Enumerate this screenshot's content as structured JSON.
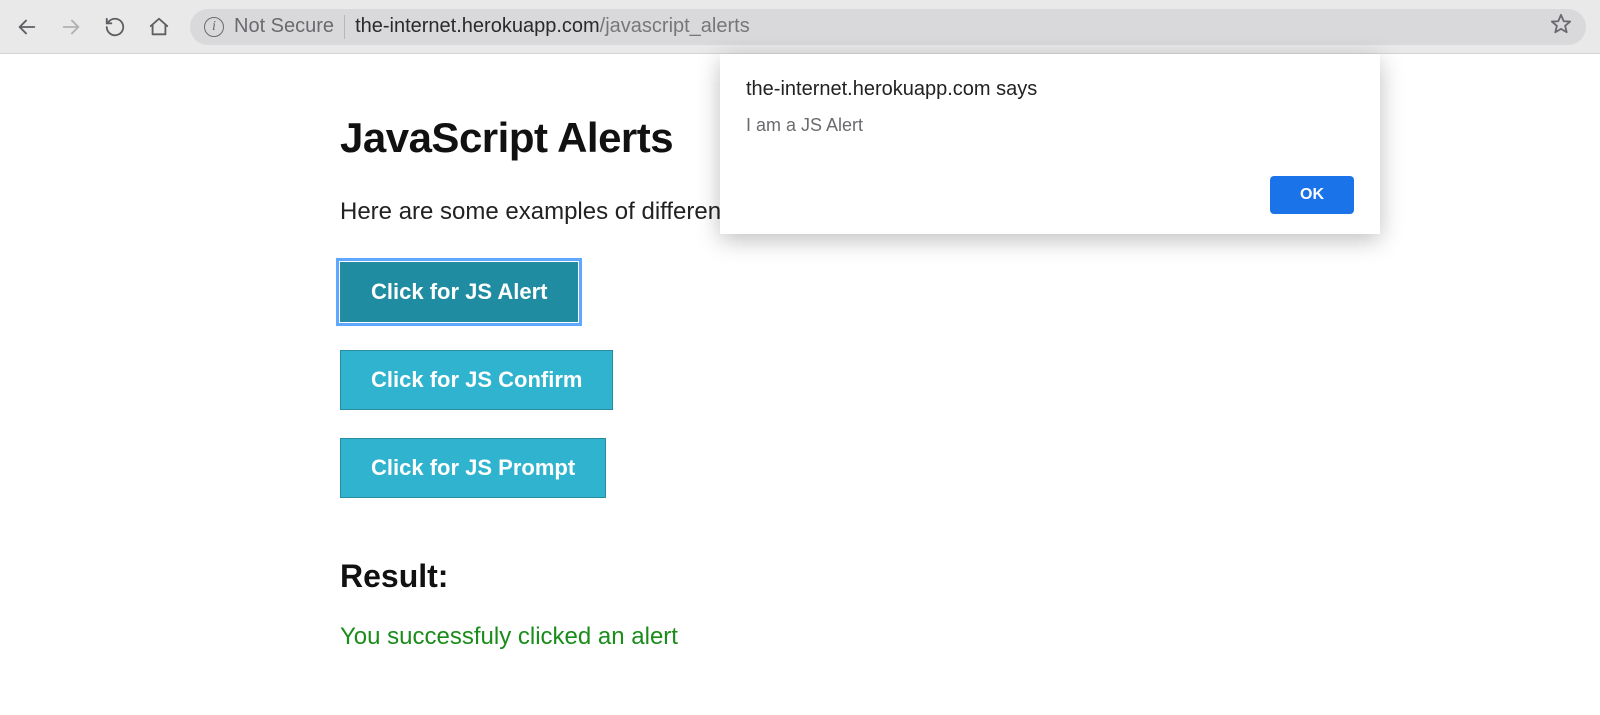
{
  "browser": {
    "not_secure_label": "Not Secure",
    "url_host": "the-internet.herokuapp.com",
    "url_path": "/javascript_alerts"
  },
  "page": {
    "title": "JavaScript Alerts",
    "intro": "Here are some examples of different",
    "buttons": [
      {
        "label": "Click for JS Alert",
        "focused": true
      },
      {
        "label": "Click for JS Confirm",
        "focused": false
      },
      {
        "label": "Click for JS Prompt",
        "focused": false
      }
    ],
    "result_heading": "Result:",
    "result_text": "You successfuly clicked an alert"
  },
  "alert": {
    "title": "the-internet.herokuapp.com says",
    "message": "I am a JS Alert",
    "ok_label": "OK"
  }
}
